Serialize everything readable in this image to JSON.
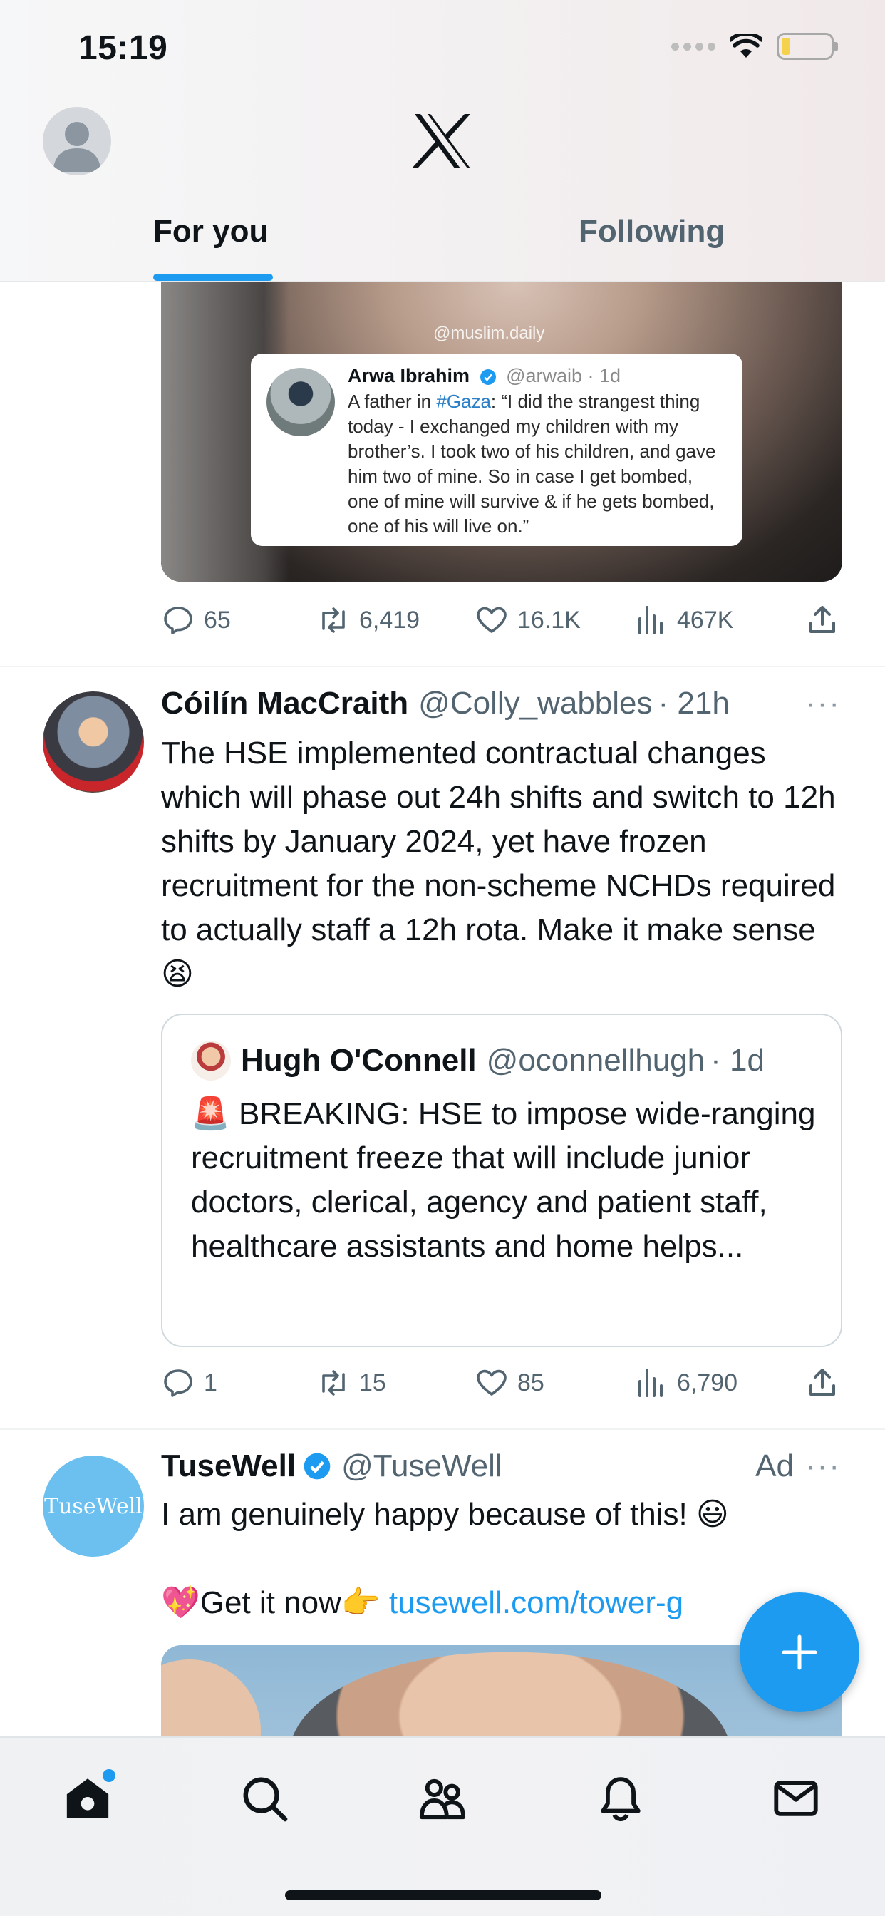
{
  "status_bar": {
    "time": "15:19"
  },
  "header": {
    "logo": "x-logo",
    "tabs": [
      {
        "label": "For you",
        "active": true
      },
      {
        "label": "Following",
        "active": false
      }
    ]
  },
  "post1": {
    "media_watermark": "@muslim.daily",
    "quoted_screenshot": {
      "name": "Arwa Ibrahim",
      "handle_time": "@arwaib · 1d",
      "text_before": "A father in ",
      "hashtag": "#Gaza",
      "text_after": ": “I did the strangest thing today - I exchanged my children with my brother’s. I took two of his children, and gave him two of mine. So in case I get bombed, one of mine will survive & if he gets bombed, one of his will live on.”"
    },
    "stats": {
      "replies": "65",
      "reposts": "6,419",
      "likes": "16.1K",
      "views": "467K"
    }
  },
  "post2": {
    "name": "Cóilín MacCraith",
    "handle": "@Colly_wabbles",
    "time": "· 21h",
    "more": "···",
    "text": "The HSE implemented contractual changes which will phase out 24h shifts and switch to 12h shifts by January 2024, yet have frozen recruitment for the non-scheme NCHDs required to actually staff a 12h rota. Make it make sense 😫",
    "quote": {
      "name": "Hugh O'Connell",
      "handle": "@oconnellhugh",
      "time": "· 1d",
      "text": "🚨 BREAKING: HSE to impose wide-ranging recruitment freeze that will include junior doctors, clerical, agency and patient staff, healthcare assistants and home helps..."
    },
    "stats": {
      "replies": "1",
      "reposts": "15",
      "likes": "85",
      "views": "6,790"
    }
  },
  "post3": {
    "avatar_text": "TuseWell",
    "name": "TuseWell",
    "handle": "@TuseWell",
    "ad_label": "Ad",
    "more": "···",
    "line1": "I am genuinely happy because of this! 😃",
    "line2_prefix": "💖Get it now👉 ",
    "link": "tusewell.com/tower-g"
  },
  "colors": {
    "accent": "#1d9bf0",
    "text": "#0f1419",
    "secondary": "#536471"
  }
}
